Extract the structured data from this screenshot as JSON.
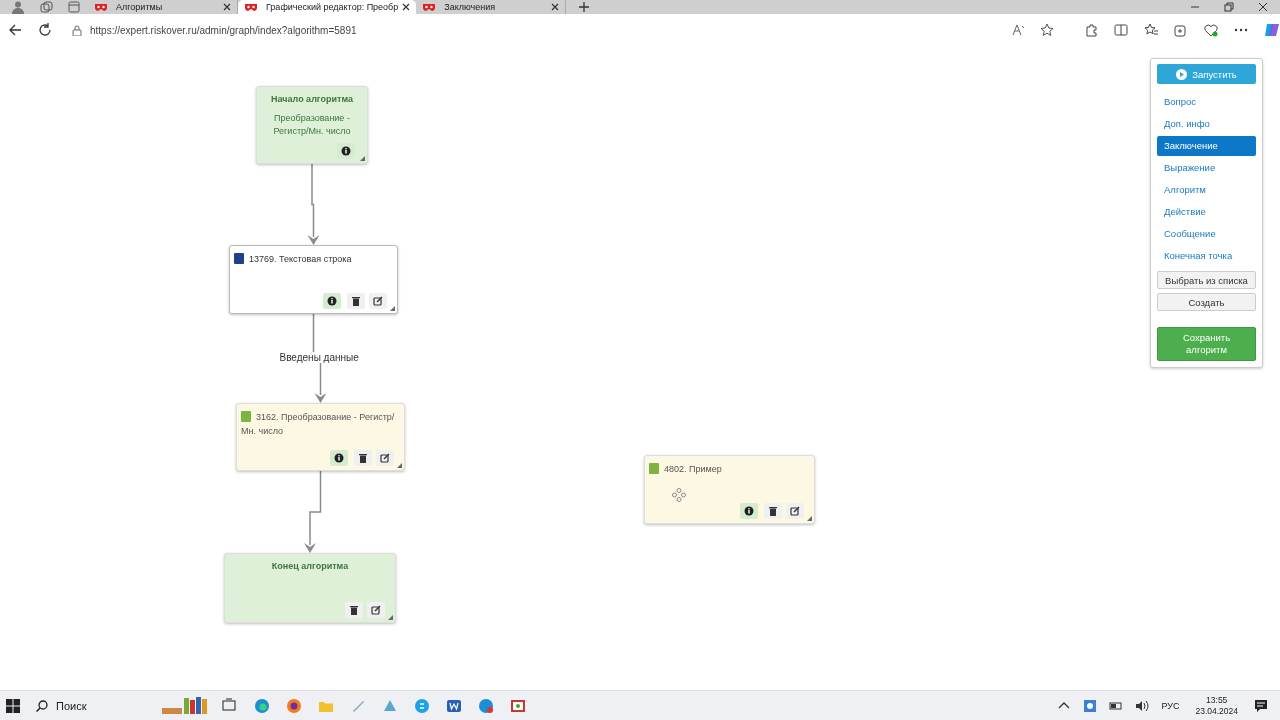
{
  "browser": {
    "tabs": [
      {
        "title": "Алгоритмы",
        "selected": false
      },
      {
        "title": "Графический редактор: Преобр",
        "selected": true
      },
      {
        "title": "Заключения",
        "selected": false
      }
    ],
    "address": "https://expert.riskover.ru/admin/graph/index?algorithm=5891"
  },
  "graph": {
    "chain": [
      {
        "kind": "start",
        "title": "Начало алгоритма",
        "subtitle": "Преобразование - Регистр/Мн. число",
        "info_button": true
      },
      {
        "kind": "question",
        "title": "13769. Текстовая строка",
        "info_button": true,
        "delete_button": true,
        "edit_button": true
      },
      {
        "kind": "conclusion",
        "title": "3162. Преобразование - Регистр/Мн. число",
        "incoming_label": "Введены данные",
        "info_button": true,
        "delete_button": true,
        "edit_button": true
      },
      {
        "kind": "end",
        "title": "Конец алгоритма",
        "delete_button": true,
        "edit_button": true
      }
    ],
    "loose_nodes": [
      {
        "kind": "conclusion",
        "title": "4802. Пример",
        "info_button": true,
        "delete_button": true,
        "edit_button": true
      }
    ]
  },
  "panel": {
    "run_button": "Запустить",
    "items": [
      {
        "label": "Вопрос",
        "selected": false
      },
      {
        "label": "Доп. инфо",
        "selected": false
      },
      {
        "label": "Заключение",
        "selected": true
      },
      {
        "label": "Выражение",
        "selected": false
      },
      {
        "label": "Алгоритм",
        "selected": false
      },
      {
        "label": "Действие",
        "selected": false
      },
      {
        "label": "Сообщение",
        "selected": false
      },
      {
        "label": "Конечная точка",
        "selected": false
      }
    ],
    "buttons": [
      {
        "kind": "plain",
        "label": "Выбрать из списка"
      },
      {
        "kind": "plain",
        "label": "Создать"
      },
      {
        "kind": "save",
        "label": "Сохранить алгоритм"
      }
    ]
  },
  "taskbar": {
    "search": "Поиск",
    "language": "РУС",
    "time": "13:55",
    "date": "23.04.2024"
  }
}
